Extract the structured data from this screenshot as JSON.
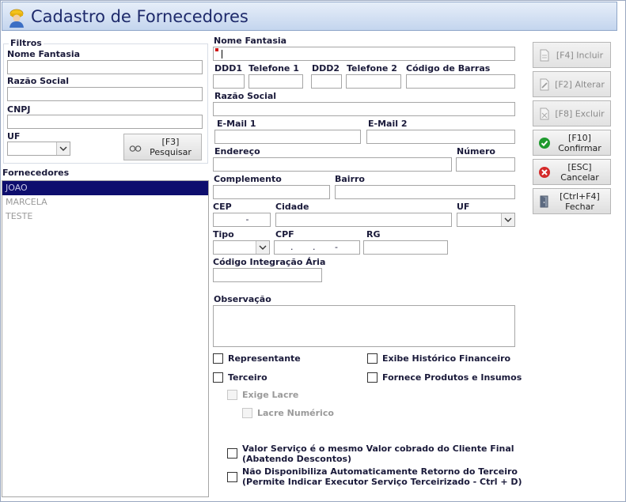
{
  "window": {
    "title": "Cadastro de Fornecedores"
  },
  "filters": {
    "group_title": "Filtros",
    "nome_fantasia_label": "Nome Fantasia",
    "razao_social_label": "Razão Social",
    "cnpj_label": "CNPJ",
    "uf_label": "UF",
    "search_button": "[F3]\nPesquisar"
  },
  "suppliers": {
    "label": "Fornecedores",
    "items": [
      "JOAO",
      "MARCELA",
      "TESTE"
    ],
    "selected_index": 0
  },
  "form": {
    "nome_fantasia": "Nome Fantasia",
    "ddd1": "DDD1",
    "telefone1": "Telefone 1",
    "ddd2": "DDD2",
    "telefone2": "Telefone 2",
    "codigo_barras": "Código de Barras",
    "razao_social": "Razão Social",
    "email1": "E-Mail 1",
    "email2": "E-Mail 2",
    "endereco": "Endereço",
    "numero": "Número",
    "complemento": "Complemento",
    "bairro": "Bairro",
    "cep": "CEP",
    "cep_mask": "-",
    "cidade": "Cidade",
    "uf": "UF",
    "tipo": "Tipo",
    "cpf": "CPF",
    "cpf_mask": ".       .       -",
    "rg": "RG",
    "codigo_integracao": "Código Integração Ária",
    "observacao": "Observação"
  },
  "checkboxes": {
    "representante": "Representante",
    "exibe_historico": "Exibe Histórico Financeiro",
    "terceiro": "Terceiro",
    "fornece_produtos": "Fornece Produtos e Insumos",
    "exige_lacre": "Exige Lacre",
    "lacre_numerico": "Lacre Numérico",
    "valor_servico_line1": "Valor Serviço é o mesmo Valor cobrado do Cliente Final",
    "valor_servico_line2": "(Abatendo Descontos)",
    "nao_disponibiliza_line1": "Não Disponibiliza Automaticamente Retorno do Terceiro",
    "nao_disponibiliza_line2": "(Permite Indicar Executor Serviço Terceirizado - Ctrl + D)"
  },
  "actions": {
    "incluir": "[F4] Incluir",
    "alterar": "[F2] Alterar",
    "excluir": "[F8] Excluir",
    "confirmar_key": "[F10]",
    "confirmar": "Confirmar",
    "cancelar_key": "[ESC]",
    "cancelar": "Cancelar",
    "fechar_key": "[Ctrl+F4]",
    "fechar": "Fechar"
  },
  "colors": {
    "title": "#1e2a6b",
    "selection": "#0e0e6e",
    "required_marker": "#d01010",
    "confirm_green": "#1f9a2e",
    "cancel_red": "#d42a2a"
  }
}
